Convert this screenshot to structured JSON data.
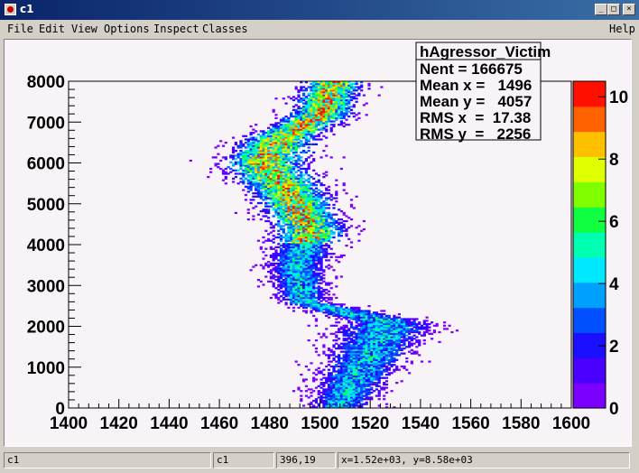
{
  "window": {
    "title": "c1",
    "minimize_label": "_",
    "maximize_label": "□",
    "close_label": "×"
  },
  "menubar": {
    "items": [
      "File",
      "Edit",
      "View",
      "Options",
      "Inspect",
      "Classes"
    ],
    "help": "Help"
  },
  "stats_box": {
    "title": "hAgressor_Victim",
    "lines": [
      "Nent = 166675",
      "Mean x =   1496",
      "Mean y =   4057",
      "RMS x  =  17.38",
      "RMS y  =   2256"
    ]
  },
  "chart_data": {
    "type": "heatmap",
    "xlim": [
      1400,
      1600
    ],
    "ylim": [
      0,
      8000
    ],
    "x_ticks": [
      "1400",
      "1420",
      "1440",
      "1460",
      "1480",
      "1500",
      "1520",
      "1540",
      "1560",
      "1580",
      "1600"
    ],
    "y_ticks": [
      "0",
      "1000",
      "2000",
      "3000",
      "4000",
      "5000",
      "6000",
      "7000",
      "8000"
    ],
    "z_range": [
      0,
      10.5
    ],
    "z_ticks": [
      "0",
      "2",
      "4",
      "6",
      "8",
      "10"
    ],
    "palette": [
      "#7b00ff",
      "#4a00ff",
      "#1a10ff",
      "#0050ff",
      "#00a0ff",
      "#00e8ff",
      "#00ffb0",
      "#10ff40",
      "#80ff00",
      "#e0ff00",
      "#ffc000",
      "#ff6000",
      "#ff1000"
    ],
    "band_center": [
      [
        0,
        1507
      ],
      [
        800,
        1514
      ],
      [
        1600,
        1522
      ],
      [
        2100,
        1527
      ],
      [
        2600,
        1493
      ],
      [
        3500,
        1490
      ],
      [
        4300,
        1496
      ],
      [
        5200,
        1488
      ],
      [
        6000,
        1477
      ],
      [
        6600,
        1484
      ],
      [
        7200,
        1500
      ],
      [
        8000,
        1505
      ]
    ],
    "band_halfwidth": [
      [
        0,
        10
      ],
      [
        1200,
        13
      ],
      [
        2000,
        16
      ],
      [
        2600,
        8
      ],
      [
        4000,
        11
      ],
      [
        6000,
        14
      ],
      [
        7000,
        11
      ],
      [
        8000,
        10
      ]
    ]
  },
  "statusbar": {
    "object": "c1",
    "canvas": "c1",
    "pixel": "396,19",
    "coords": "x=1.52e+03, y=8.58e+03"
  }
}
